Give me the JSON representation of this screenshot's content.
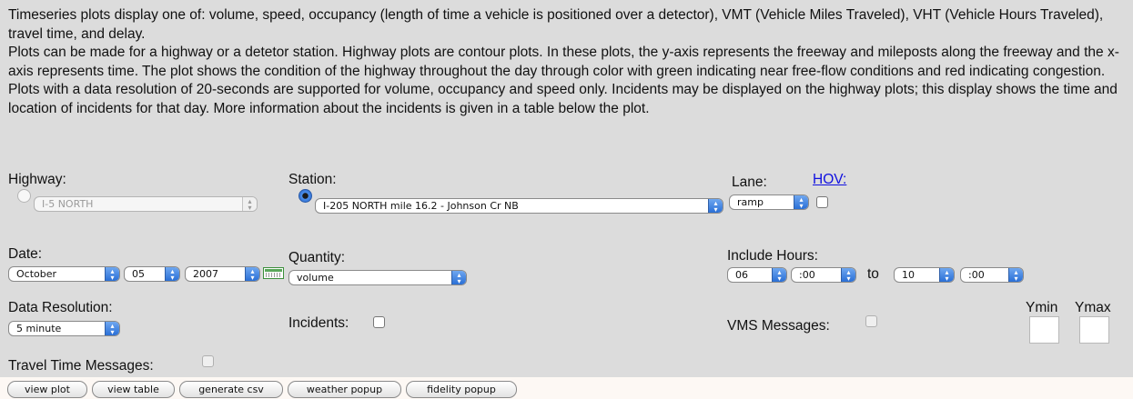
{
  "description": {
    "p1": "Timeseries plots display one of: volume, speed, occupancy (length of time a vehicle is positioned over a detector), VMT (Vehicle Miles Traveled), VHT (Vehicle Hours Traveled), travel time, and delay.",
    "p2": "Plots can be made for a highway or a detetor station. Highway plots are contour plots. In these plots, the y-axis represents the freeway and mileposts along the freeway and the x-axis represents time. The plot shows the condition of the highway throughout the day through color with green indicating near free-flow conditions and red indicating congestion. Plots with a data resolution of 20-seconds are supported for volume, occupancy and speed only. Incidents may be displayed on the highway plots; this display shows the time and location of incidents for that day. More information about the incidents is given in a table below the plot."
  },
  "highway": {
    "label": "Highway:",
    "selected": "I-5 NORTH",
    "radio_checked": false,
    "enabled": false
  },
  "station": {
    "label": "Station:",
    "selected": "I-205 NORTH mile 16.2 - Johnson Cr NB",
    "radio_checked": true
  },
  "lane": {
    "label": "Lane:",
    "selected": "ramp",
    "hov_link": "HOV:",
    "hov_checked": false
  },
  "date": {
    "label": "Date:",
    "month": "October",
    "day": "05",
    "year": "2007",
    "calendar_icon": "calendar-icon"
  },
  "quantity": {
    "label": "Quantity:",
    "selected": "volume"
  },
  "include_hours": {
    "label": "Include Hours:",
    "from_hour": "06",
    "from_min": ":00",
    "to_text": "to",
    "to_hour": "10",
    "to_min": ":00"
  },
  "data_resolution": {
    "label": "Data Resolution:",
    "selected": "5 minute"
  },
  "incidents": {
    "label": "Incidents:",
    "checked": false
  },
  "vms": {
    "label": "VMS Messages:",
    "checked": false,
    "enabled": false
  },
  "ymin": {
    "label": "Ymin",
    "value": ""
  },
  "ymax": {
    "label": "Ymax",
    "value": ""
  },
  "travel_time": {
    "label": "Travel Time Messages:",
    "checked": false,
    "enabled": false
  },
  "buttons": {
    "view_plot": "view plot",
    "view_table": "view table",
    "generate_csv": "generate csv",
    "weather_popup": "weather popup",
    "fidelity_popup": "fidelity popup"
  },
  "colors": {
    "panel_bg": "#dcdcdc",
    "page_bg": "#fdf8f4",
    "select_arrow": "#2a6fd6",
    "link": "#1010e0"
  }
}
